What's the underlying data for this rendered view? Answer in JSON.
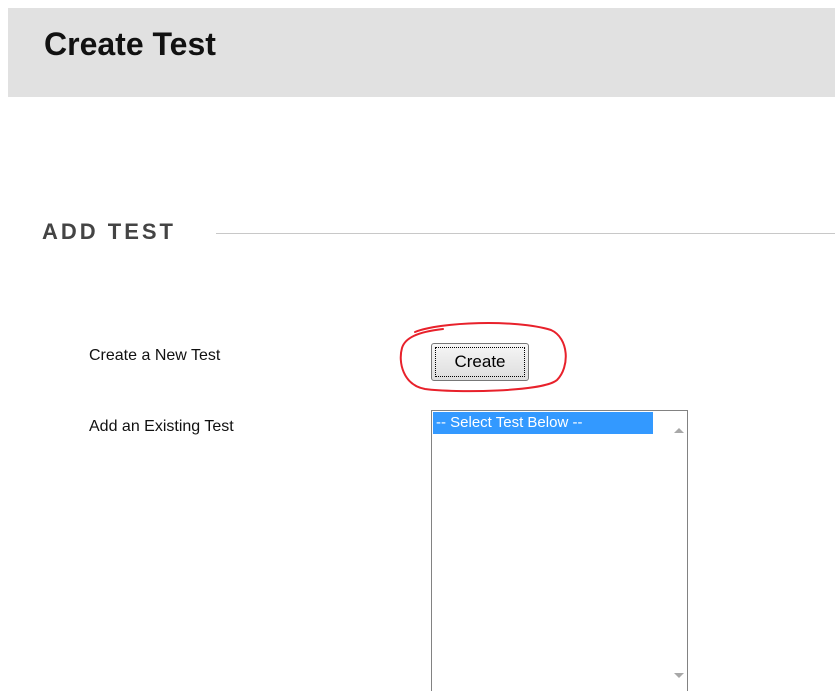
{
  "header": {
    "title": "Create Test"
  },
  "section": {
    "title": "ADD TEST"
  },
  "form": {
    "create_new_label": "Create a New Test",
    "create_button_label": "Create",
    "add_existing_label": "Add an Existing Test",
    "existing_tests": {
      "selected_option": "-- Select Test Below --"
    }
  },
  "colors": {
    "header_bg": "#e1e1e1",
    "selection_bg": "#3399ff",
    "annotation": "#e8212b"
  },
  "icons": {
    "scroll_up": "scroll-up-arrow-icon",
    "scroll_down": "scroll-down-arrow-icon"
  }
}
